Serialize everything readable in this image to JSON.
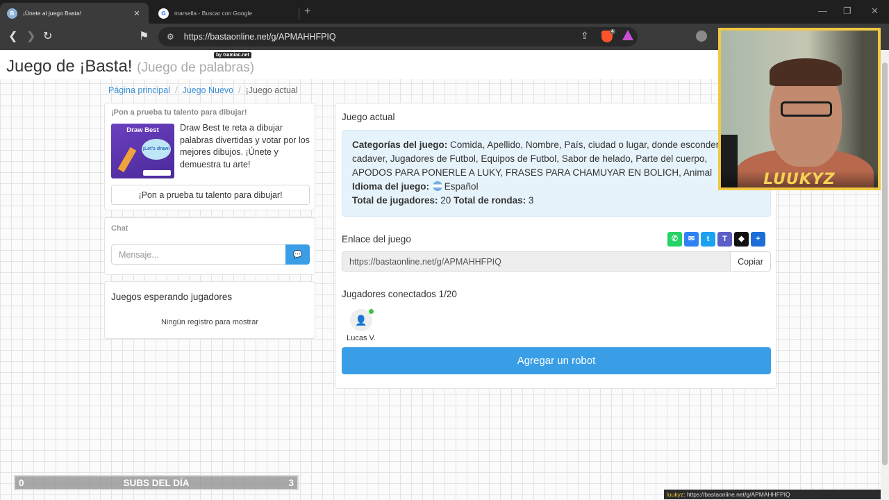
{
  "browser": {
    "tabs": [
      {
        "title": "¡Únete al juego Basta!",
        "active": true
      },
      {
        "title": "marsella - Buscar con Google",
        "active": false
      }
    ],
    "close_glyph": "✕",
    "new_tab_glyph": "+",
    "address": "https://bastaonline.net/g/APMAHHFPIQ",
    "brave_badge": "4"
  },
  "header": {
    "title": "Juego de ¡Basta!",
    "subtitle": "(Juego de palabras)",
    "badge": "by Gamiac.net"
  },
  "breadcrumb": {
    "items": [
      "Página principal",
      "Juego Nuevo"
    ],
    "current": "¡Juego actual",
    "separator": "/"
  },
  "promo": {
    "title": "¡Pon a prueba tu talento para dibujar!",
    "image_title": "Draw Best",
    "image_cloud": "¡Let's draw!",
    "text": "Draw Best te reta a dibujar palabras divertidas y votar por los mejores dibujos. ¡Únete y demuestra tu arte!",
    "button": "¡Pon a prueba tu talento para dibujar!"
  },
  "chat": {
    "title": "Chat",
    "placeholder": "Mensaje...",
    "send_icon": "💬"
  },
  "waiting": {
    "title": "Juegos esperando jugadores",
    "empty": "Ningún registro para mostrar"
  },
  "game": {
    "title": "Juego actual",
    "categories_label": "Categorías del juego:",
    "categories_lines": [
      "Comida, Apellido, Nombre, País, ciudad o lugar, donde esconderías un",
      "cadaver, Jugadores de Futbol, Equipos de Futbol, Sabor de helado, Parte del cuerpo,",
      "APODOS PARA PONERLE A LUKY, FRASES PARA CHAMUYAR EN BOLICH, Animal"
    ],
    "language_label": "Idioma del juego:",
    "language": "Español",
    "players_label": "Total de jugadores:",
    "players_total": "20",
    "rounds_label": "Total de rondas:",
    "rounds_total": "3",
    "link_title": "Enlace del juego",
    "link": "https://bastaonline.net/g/APMAHHFPIQ",
    "copy": "Copiar",
    "share_buttons": [
      {
        "name": "whatsapp-icon",
        "glyph": "✆",
        "color": "#25d366"
      },
      {
        "name": "messenger-icon",
        "glyph": "✉",
        "color": "#2e82f6"
      },
      {
        "name": "twitter-icon",
        "glyph": "t",
        "color": "#1da1f2"
      },
      {
        "name": "teams-icon",
        "glyph": "T",
        "color": "#5b5fc7"
      },
      {
        "name": "snapchat-icon",
        "glyph": "◆",
        "color": "#111111"
      },
      {
        "name": "share-more-icon",
        "glyph": "+",
        "color": "#1b6ed8"
      }
    ],
    "connected_title": "Jugadores conectados 1/20",
    "players": [
      {
        "name": "Lucas V."
      }
    ],
    "add_robot": "Agregar un robot"
  },
  "overlay": {
    "webcam_label": "LUUKYZ",
    "subs_left": "0",
    "subs_title": "SUBS DEL DÍA",
    "subs_right": "3",
    "status_user": "luukyz",
    "status_text": ": https://bastaonline.net/g/APMAHHFPIQ"
  }
}
